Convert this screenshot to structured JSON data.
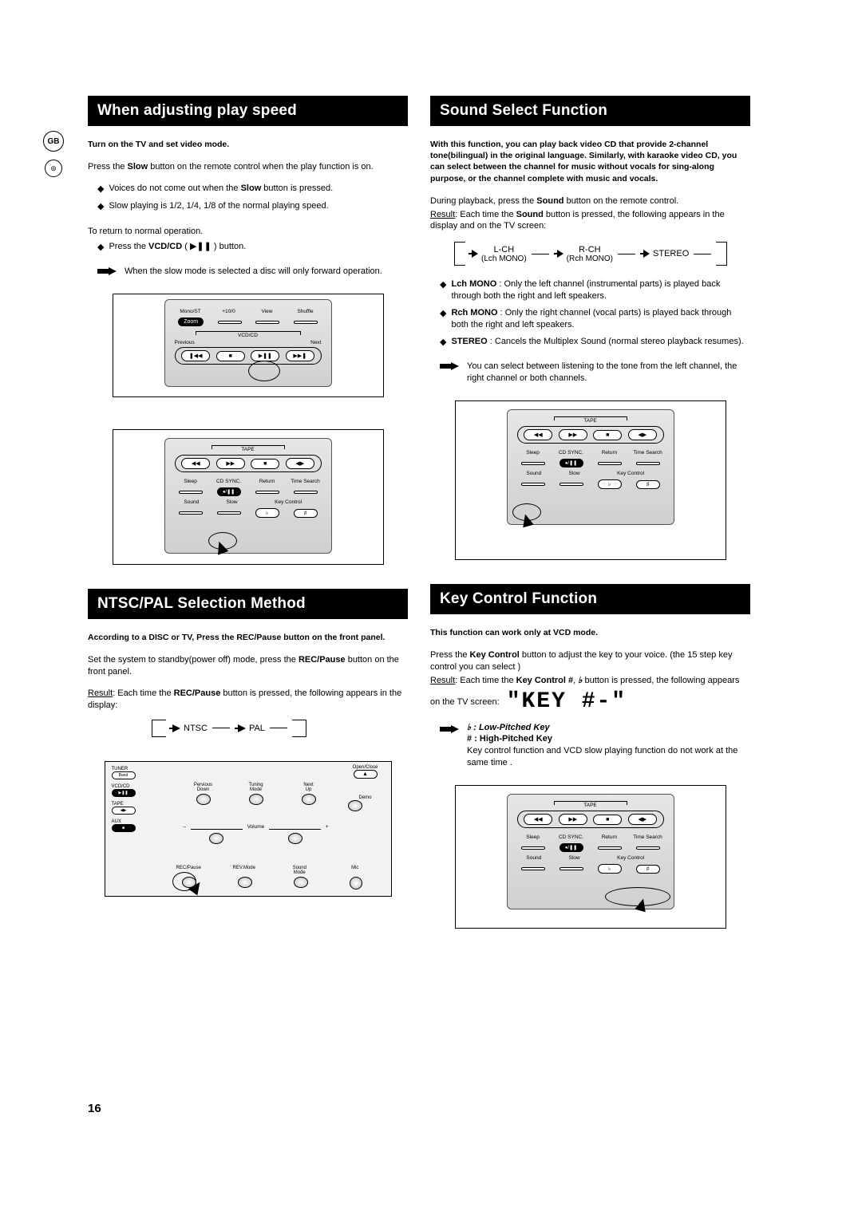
{
  "page_number": "16",
  "sidebar": {
    "lang": "GB",
    "disc": "⊚"
  },
  "left": {
    "section1": {
      "title": "When adjusting play speed",
      "intro": "Turn on the TV and set video mode.",
      "p1a": "Press the ",
      "p1b": "Slow",
      "p1c": " button on the remote control when the play function is on.",
      "d1": "Voices do not come out when the ",
      "d1b": "Slow",
      "d1c": " button is pressed.",
      "d2": "Slow playing is 1/2, 1/4, 1/8 of the normal playing speed.",
      "ret1": "To return to normal operation.",
      "ret2a": "Press the ",
      "ret2b": "VCD/CD",
      "ret2c": " ( ▶❚❚ ) button.",
      "note": "When the slow mode is selected a disc will only forward operation."
    },
    "remote1": {
      "row1": [
        "Mono/ST",
        "+10/0",
        "View",
        "Shuffle"
      ],
      "zoom": "Zoom",
      "mid": "VCD/CD",
      "prev": "Previous",
      "next": "Next",
      "trans": [
        "❚◀◀",
        "■",
        "▶❚❚",
        "▶▶❚"
      ]
    },
    "remote2": {
      "tape": "TAPE",
      "tapebtns": [
        "◀◀",
        "▶▶",
        "■",
        "◀▶"
      ],
      "row1": [
        "Sleep",
        "CD SYNC.",
        "Return",
        "Time Search"
      ],
      "row2l": [
        "Sound",
        "Slow"
      ],
      "keyctrl": "Key Control",
      "keybtns": [
        "♭",
        "♯"
      ]
    },
    "section2": {
      "title": "NTSC/PAL Selection Method",
      "intro": "According to a DISC or TV, Press the REC/Pause button on the front panel.",
      "p1a": "Set the system to standby(power off) mode, press the ",
      "p1b": "REC/Pause",
      "p1c": " button on the front panel.",
      "res_u": "Result",
      "res_rest": ": Each time the ",
      "res_b": "REC/Pause",
      "res_end": " button is pressed,  the following appears in the display:",
      "cycle": {
        "a": "NTSC",
        "b": "PAL"
      }
    },
    "panel": {
      "col_left": [
        "TUNER",
        "VCD/CD",
        "TAPE",
        "AUX"
      ],
      "top_row": [
        "Pervious",
        "Tuning",
        "Next"
      ],
      "top_sub": [
        "Down",
        "Mode",
        "Up"
      ],
      "open": "Open/Close",
      "demo": "Demo",
      "vol": "Volume",
      "minus": "–",
      "plus": "+",
      "bottom": [
        "REC/Pause",
        "REV.Mode",
        "Sound\nMode",
        "Mic"
      ],
      "band": "Band"
    }
  },
  "right": {
    "section1": {
      "title": "Sound Select Function",
      "intro": "With this function, you can play back video CD that provide 2-channel tone(bilingual) in the original language. Similarly, with karaoke video CD, you can select between the channel for music without vocals for sing-along purpose, or the channel complete with music and vocals.",
      "p1a": "During playback, press the ",
      "p1b": "Sound",
      "p1c": " button on the remote control.",
      "res_u": "Result",
      "res_rest": ": Each time the ",
      "res_b": "Sound",
      "res_end": " button is pressed, the following appears in the display and on the TV screen:",
      "cycle": {
        "a": "L-CH",
        "a_sub": "(Lch MONO)",
        "b": "R-CH",
        "b_sub": "(Rch MONO)",
        "c": "STEREO"
      },
      "d1_b": "Lch MONO",
      "d1_t": " : Only the left channel (instrumental parts) is played back through both the right and left speakers.",
      "d2_b": "Rch MONO",
      "d2_t": " : Only the right channel (vocal parts) is played back through both the right and left speakers.",
      "d3_b": "STEREO",
      "d3_t": " : Cancels the Multiplex Sound (normal stereo playback resumes).",
      "note": "You can select between listening to the tone from the left channel, the right channel or both channels."
    },
    "section2": {
      "title": "Key Control Function",
      "intro": "This function can work only at VCD mode.",
      "p1a": "Press the ",
      "p1b": "Key Control",
      "p1c": " button to adjust the key to your voice. (the 15 step key control you can select )",
      "res_u": "Result",
      "res_rest": ": Each time the ",
      "res_b1": "Key Control  #",
      "res_mid": ", ",
      "res_b2": "♭",
      "res_end": " button is pressed,  the following appears on the TV screen:",
      "lcd": "\"KEY #-\"",
      "note_b": "♭ : Low-Pitched Key",
      "note_s": "# : High-Pitched Key",
      "note_rest": "Key control function and VCD slow playing function do not work at the same time ."
    }
  }
}
